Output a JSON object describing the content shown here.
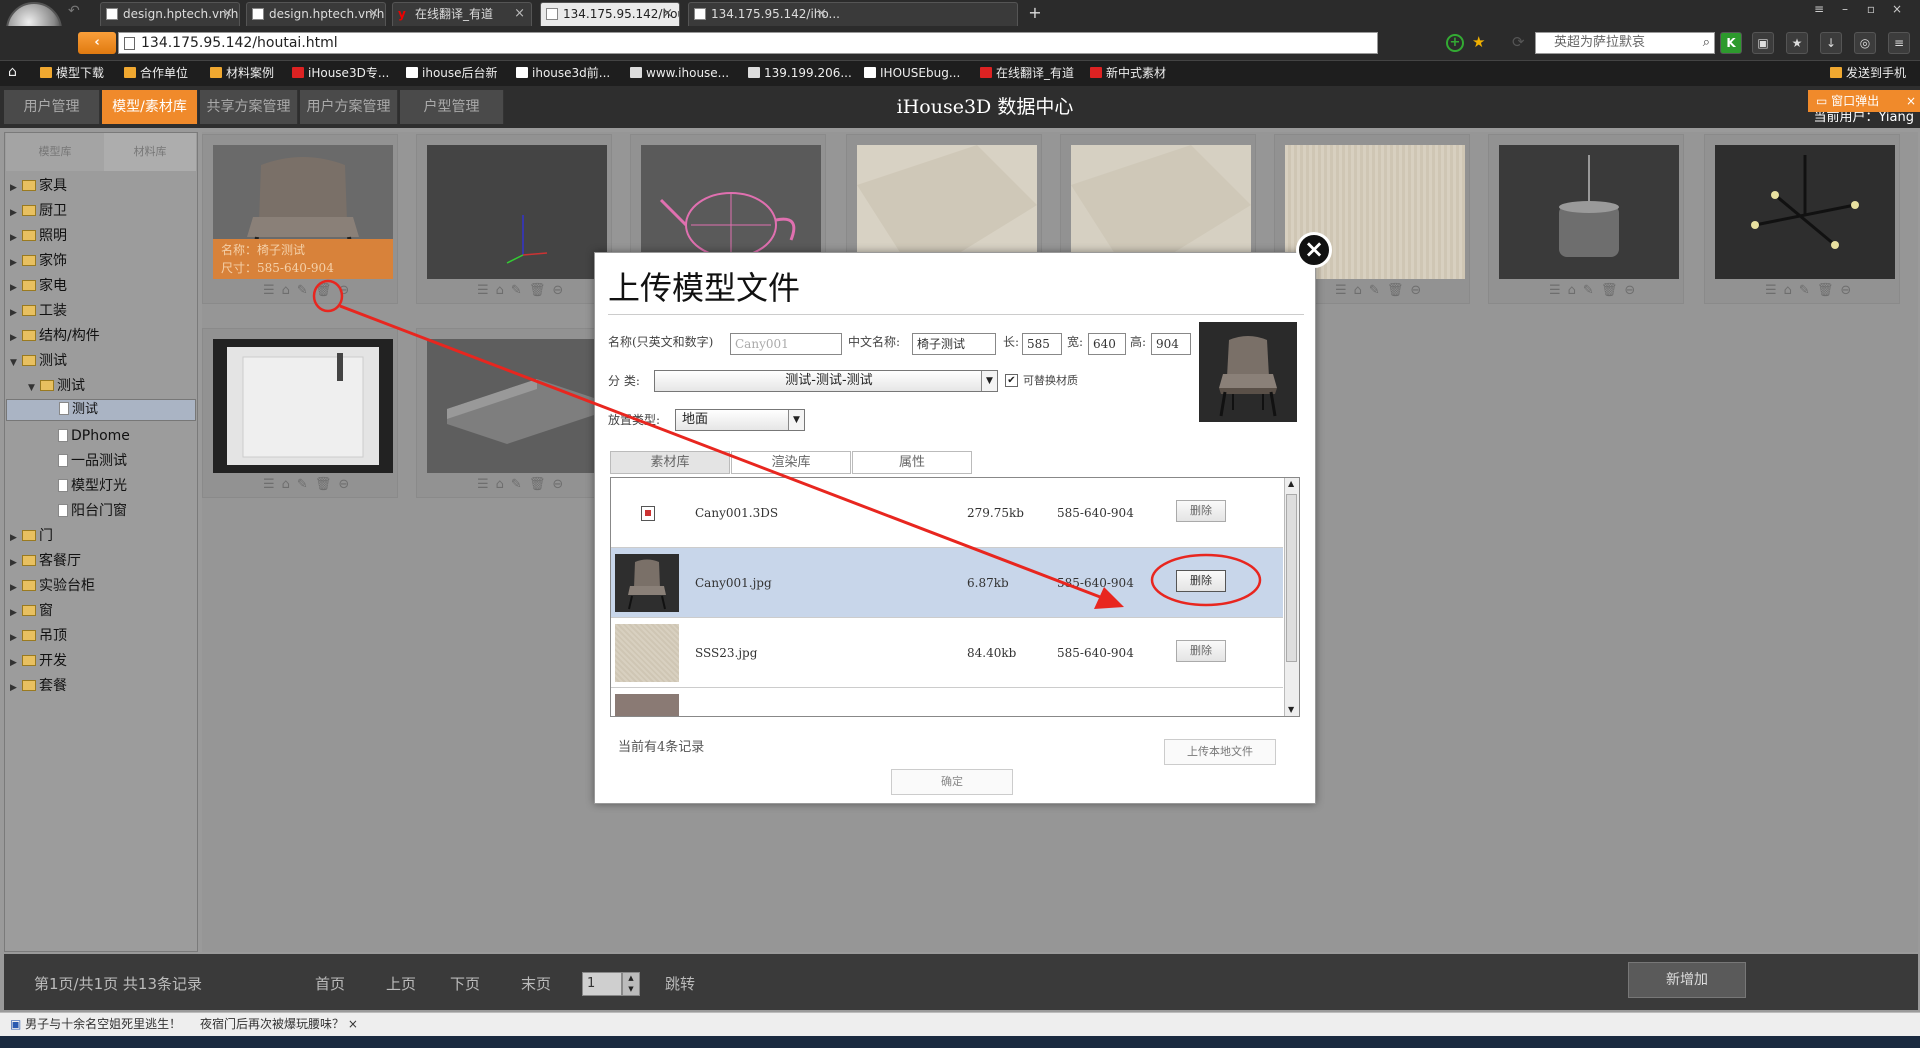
{
  "browser": {
    "tabs": [
      {
        "label": "design.hptech.vn/h...",
        "active": false
      },
      {
        "label": "design.hptech.vn/h...",
        "active": false
      },
      {
        "label": "在线翻译_有道",
        "active": false
      },
      {
        "label": "134.175.95.142/hou",
        "active": true
      },
      {
        "label": "134.175.95.142/iho...",
        "active": false
      }
    ],
    "url": "134.175.95.142/houtai.html",
    "search_placeholder": "英超为萨拉默哀",
    "bookmarks": [
      "模型下载",
      "合作单位",
      "材料案例",
      "iHouse3D专...",
      "ihouse后台新",
      "ihouse3d前...",
      "www.ihouse...",
      "139.199.206...",
      "IHOUSEbug...",
      "在线翻译_有道",
      "新中式素材"
    ],
    "send_to_phone": "发送到手机"
  },
  "app": {
    "nav_tabs": [
      "用户管理",
      "模型/素材库",
      "共享方案管理",
      "用户方案管理",
      "户型管理"
    ],
    "active_tab": "模型/素材库",
    "title": "iHouse3D 数据中心",
    "popup_label": "窗口弹出",
    "current_user": "当前用户：Yiang"
  },
  "sidebar": {
    "tabs": [
      "模型库",
      "材料库"
    ],
    "tree": [
      {
        "label": "家具",
        "level": 0,
        "open": false
      },
      {
        "label": "厨卫",
        "level": 0,
        "open": false
      },
      {
        "label": "照明",
        "level": 0,
        "open": false
      },
      {
        "label": "家饰",
        "level": 0,
        "open": false
      },
      {
        "label": "家电",
        "level": 0,
        "open": false
      },
      {
        "label": "工装",
        "level": 0,
        "open": false
      },
      {
        "label": "结构/构件",
        "level": 0,
        "open": false
      },
      {
        "label": "测试",
        "level": 0,
        "open": true
      },
      {
        "label": "测试",
        "level": 1,
        "open": true
      },
      {
        "label": "测试",
        "level": 2,
        "leaf": true,
        "selected": true
      },
      {
        "label": "DPhome",
        "level": 2,
        "leaf": true
      },
      {
        "label": "一品测试",
        "level": 2,
        "leaf": true
      },
      {
        "label": "模型灯光",
        "level": 2,
        "leaf": true
      },
      {
        "label": "阳台门窗",
        "level": 2,
        "leaf": true
      },
      {
        "label": "门",
        "level": 0,
        "open": false
      },
      {
        "label": "客餐厅",
        "level": 0,
        "open": false
      },
      {
        "label": "实验台柜",
        "level": 0,
        "open": false
      },
      {
        "label": "窗",
        "level": 0,
        "open": false
      },
      {
        "label": "吊顶",
        "level": 0,
        "open": false
      },
      {
        "label": "开发",
        "level": 0,
        "open": false
      },
      {
        "label": "套餐",
        "level": 0,
        "open": false
      }
    ]
  },
  "grid": {
    "first_card": {
      "name": "名称：椅子测试",
      "size": "尺寸：585-640-904"
    },
    "action_icons": [
      "list-icon",
      "tag-icon",
      "edit-icon",
      "delete-icon",
      "more-icon"
    ]
  },
  "pager": {
    "summary": "第1页/共1页 共13条记录",
    "first": "首页",
    "prev": "上页",
    "next": "下页",
    "last": "末页",
    "page_value": "1",
    "jump": "跳转",
    "add_new": "新增加"
  },
  "modal": {
    "title": "上传模型文件",
    "name_label": "名称(只英文和数字)",
    "name_value": "Cany001",
    "cn_name_label": "中文名称:",
    "cn_name_value": "椅子测试",
    "len_label": "长:",
    "len_value": "585",
    "wid_label": "宽:",
    "wid_value": "640",
    "hei_label": "高:",
    "hei_value": "904",
    "category_label": "分 类:",
    "category_value": "测试-测试-测试",
    "replaceable_label": "可替换材质",
    "place_label": "放置类型:",
    "place_value": "地面",
    "tabs": [
      "素材库",
      "渲染库",
      "属性"
    ],
    "files": [
      {
        "name": "Cany001.3DS",
        "size": "279.75kb",
        "dims": "585-640-904",
        "delete": "删除"
      },
      {
        "name": "Cany001.jpg",
        "size": "6.87kb",
        "dims": "585-640-904",
        "delete": "删除"
      },
      {
        "name": "SSS23.jpg",
        "size": "84.40kb",
        "dims": "585-640-904",
        "delete": "删除"
      }
    ],
    "record_count": "当前有4条记录",
    "upload_local": "上传本地文件",
    "confirm": "确定"
  },
  "news": [
    "男子与十余名空姐死里逃生！",
    "夜宿门后再次被爆玩腰味？"
  ],
  "colors": {
    "accent": "#f08a2b",
    "annotation": "#e8261f",
    "selected_row": "#c8d6ea"
  }
}
